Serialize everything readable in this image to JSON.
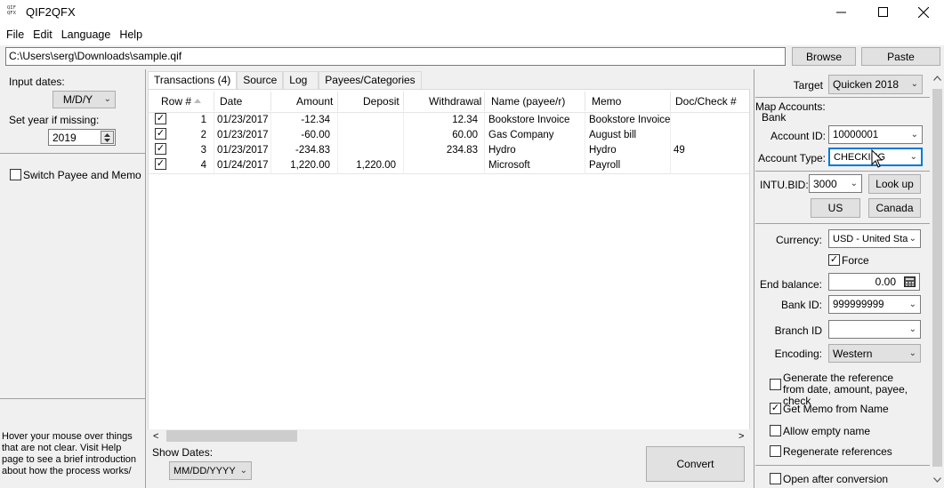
{
  "window": {
    "title": "QIF2QFX",
    "icon_text_top": "QIF",
    "icon_text_bottom": "QFX"
  },
  "menu": [
    "File",
    "Edit",
    "Language",
    "Help"
  ],
  "file_path": "C:\\Users\\serg\\Downloads\\sample.qif",
  "buttons": {
    "browse": "Browse",
    "paste": "Paste",
    "convert": "Convert",
    "lookup": "Look up",
    "us": "US",
    "canada": "Canada"
  },
  "left": {
    "input_dates_label": "Input dates:",
    "input_dates_value": "M/D/Y",
    "set_year_label": "Set year if missing:",
    "year_value": "2019",
    "switch_payee_memo": "Switch Payee and Memo",
    "hint": "Hover your mouse over things that are not clear. Visit Help page to see a brief introduction about how the process works/"
  },
  "tabs": [
    "Transactions (4)",
    "Source",
    "Log",
    "Payees/Categories"
  ],
  "table": {
    "columns": [
      "Row #",
      "Date",
      "Amount",
      "Deposit",
      "Withdrawal",
      "Name (payee/r)",
      "Memo",
      "Doc/Check #"
    ],
    "rows": [
      {
        "row": "1",
        "date": "01/23/2017",
        "amount": "-12.34",
        "deposit": "",
        "withdrawal": "12.34",
        "name": "Bookstore Invoice",
        "memo": "Bookstore Invoice",
        "doc": ""
      },
      {
        "row": "2",
        "date": "01/23/2017",
        "amount": "-60.00",
        "deposit": "",
        "withdrawal": "60.00",
        "name": "Gas Company",
        "memo": "August bill",
        "doc": ""
      },
      {
        "row": "3",
        "date": "01/23/2017",
        "amount": "-234.83",
        "deposit": "",
        "withdrawal": "234.83",
        "name": "Hydro",
        "memo": "Hydro",
        "doc": "49"
      },
      {
        "row": "4",
        "date": "01/24/2017",
        "amount": "1,220.00",
        "deposit": "1,220.00",
        "withdrawal": "",
        "name": "Microsoft",
        "memo": "Payroll",
        "doc": ""
      }
    ]
  },
  "show_dates": {
    "label": "Show Dates:",
    "value": "MM/DD/YYYY"
  },
  "right": {
    "target_label": "Target",
    "target_value": "Quicken 2018",
    "map_accounts_label": "Map Accounts:",
    "bank_label": "Bank",
    "account_id_label": "Account ID:",
    "account_id_value": "10000001",
    "account_type_label": "Account Type:",
    "account_type_value": "CHECKING",
    "intu_bid_label": "INTU.BID:",
    "intu_bid_value": "3000",
    "currency_label": "Currency:",
    "currency_value": "USD - United Sta",
    "force_label": "Force",
    "end_balance_label": "End balance:",
    "end_balance_value": "0.00",
    "bank_id_label": "Bank ID:",
    "bank_id_value": "999999999",
    "branch_id_label": "Branch ID",
    "branch_id_value": "",
    "encoding_label": "Encoding:",
    "encoding_value": "Western",
    "gen_ref_label": "Generate the reference from date, amount, payee, check",
    "get_memo_label": "Get Memo from Name",
    "allow_empty_label": "Allow empty name",
    "regen_label": "Regenerate references",
    "open_after_label": "Open after conversion"
  }
}
